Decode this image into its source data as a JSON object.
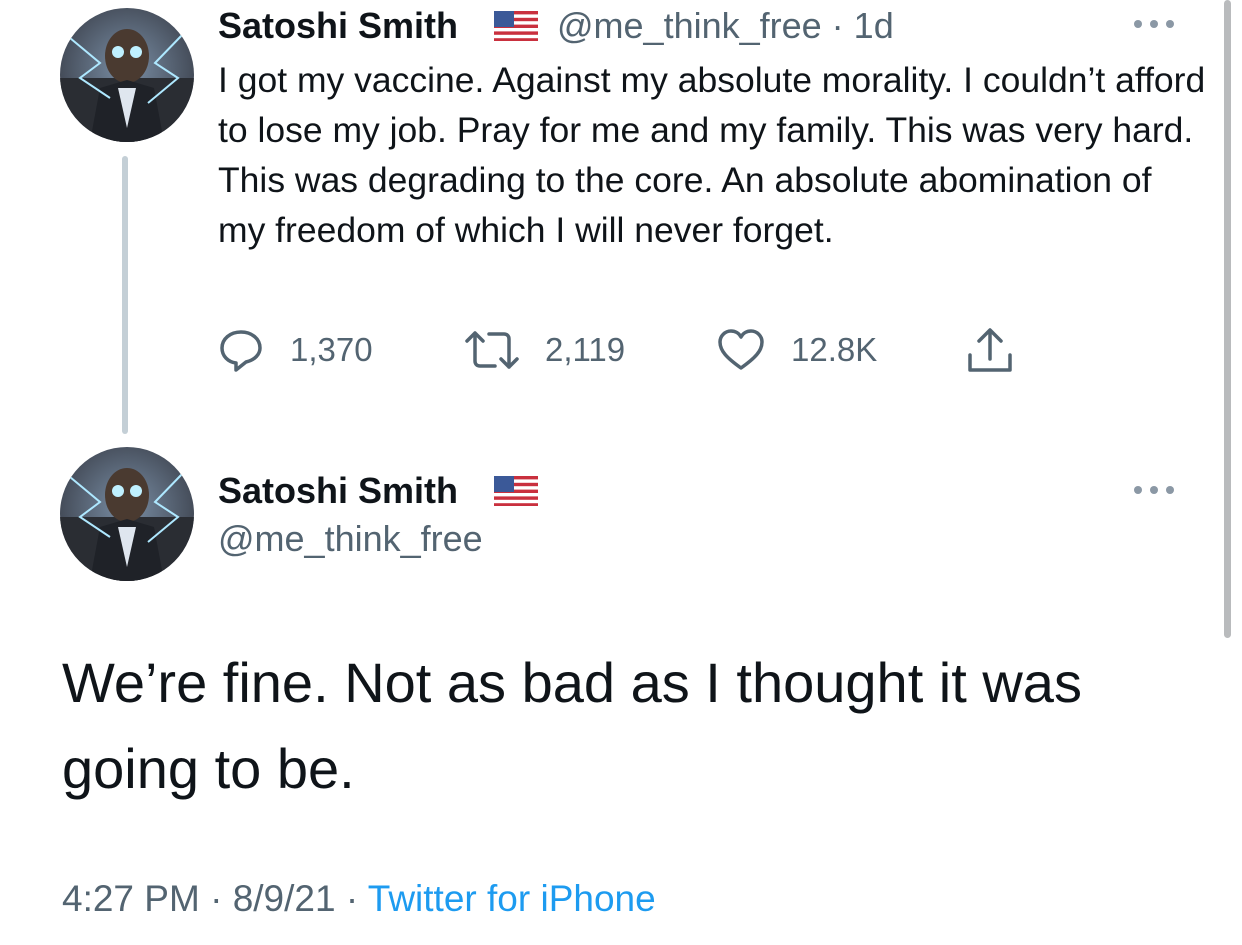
{
  "parent_tweet": {
    "author_name": "Satoshi Smith",
    "handle_and_time": "@me_think_free · 1d",
    "flag_icon": "us-flag-icon",
    "text": "I got my vaccine. Against my absolute morality. I couldn’t afford to lose my job. Pray for me and my family. This was very hard. This was degrading to the core. An absolute abomination of my freedom of which I will never forget.",
    "actions": {
      "reply_count": "1,370",
      "retweet_count": "2,119",
      "like_count": "12.8K"
    }
  },
  "main_tweet": {
    "author_name": "Satoshi Smith",
    "handle": "@me_think_free",
    "flag_icon": "us-flag-icon",
    "text": "We’re fine. Not as bad as I thought it was going to be.",
    "meta": {
      "time": "4:27 PM",
      "separator": " · ",
      "date": "8/9/21",
      "source": "Twitter for iPhone"
    }
  },
  "colors": {
    "text_primary": "#0f1419",
    "text_secondary": "#536471",
    "link": "#1d9bf0",
    "thread_line": "#c4cfd6"
  }
}
